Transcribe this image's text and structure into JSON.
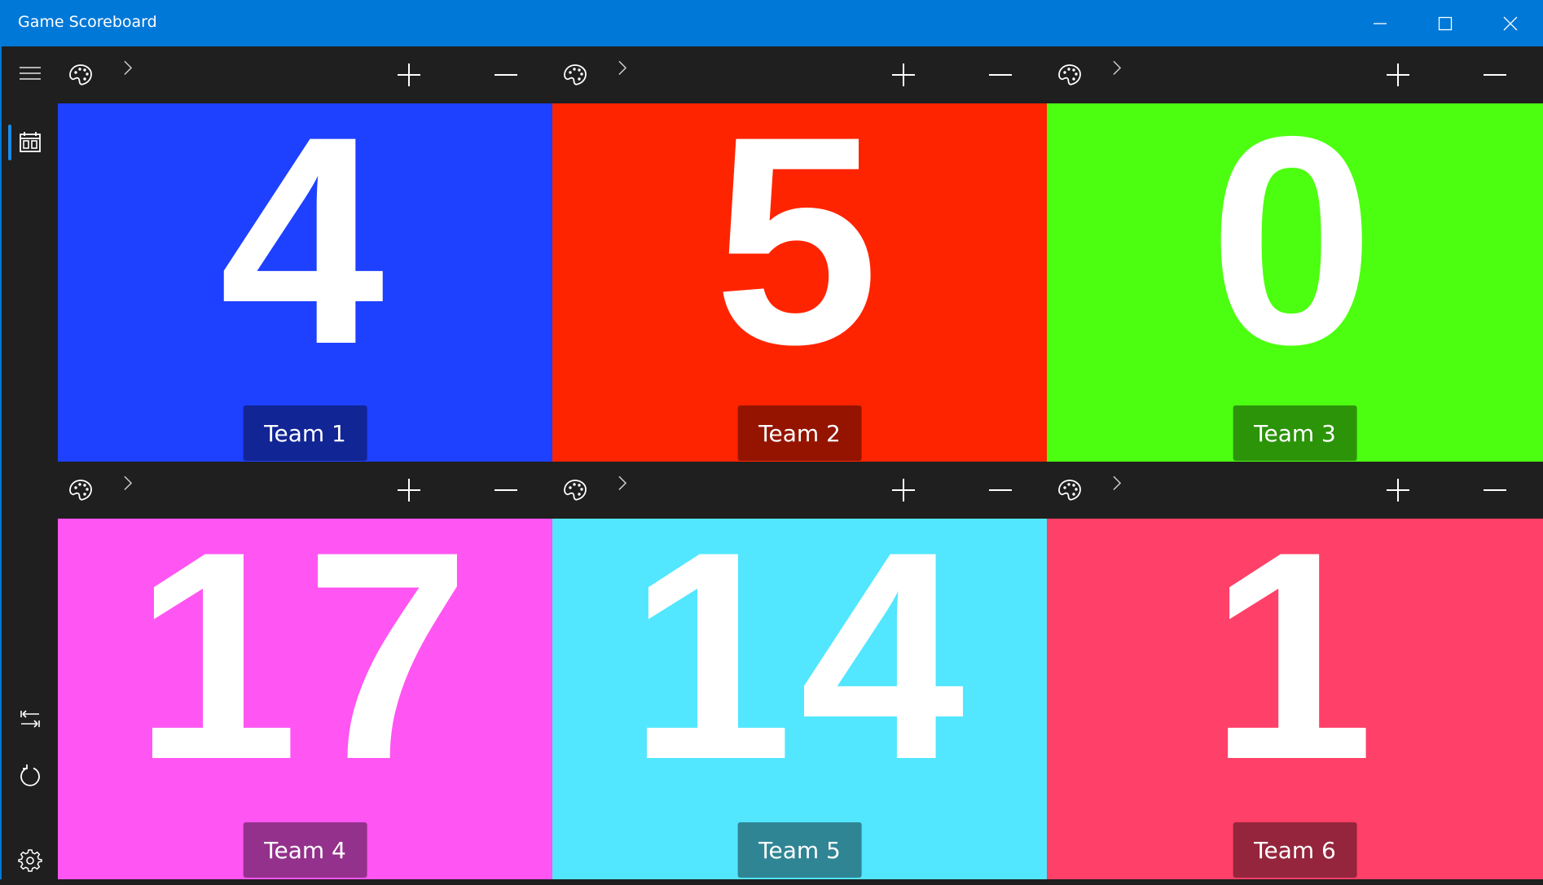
{
  "window": {
    "title": "Game Scoreboard",
    "controls": {
      "minimize": "minimize-icon",
      "maximize": "maximize-icon",
      "close": "close-icon"
    }
  },
  "sidebar": {
    "top_items": [
      {
        "id": "menu",
        "icon": "hamburger-menu-icon"
      },
      {
        "id": "scoreboard",
        "icon": "scoreboard-icon",
        "selected": true
      }
    ],
    "bottom_items": [
      {
        "id": "swap",
        "icon": "swap-order-icon"
      },
      {
        "id": "reset",
        "icon": "reset-icon"
      },
      {
        "id": "settings",
        "icon": "gear-icon"
      }
    ],
    "accent_color": "#1a8ae6"
  },
  "toolbar": {
    "color_icon": "palette-icon",
    "expand_icon": "chevron-right-icon",
    "increment_icon": "plus-icon",
    "decrement_icon": "minus-icon"
  },
  "teams": [
    {
      "name": "Team 1",
      "score": "4",
      "color": "#1e40ff"
    },
    {
      "name": "Team 2",
      "score": "5",
      "color": "#ff2400"
    },
    {
      "name": "Team 3",
      "score": "0",
      "color": "#4cff10"
    },
    {
      "name": "Team 4",
      "score": "17",
      "color": "#ff55f2"
    },
    {
      "name": "Team 5",
      "score": "14",
      "color": "#52e6ff"
    },
    {
      "name": "Team 6",
      "score": "1",
      "color": "#ff4068"
    }
  ]
}
